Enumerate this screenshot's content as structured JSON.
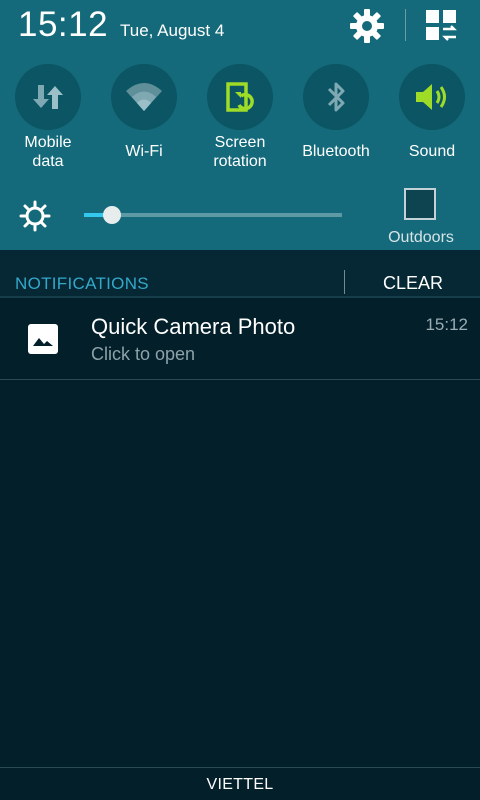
{
  "status": {
    "time": "15:12",
    "date": "Tue, August 4"
  },
  "toggles": [
    {
      "label": "Mobile\ndata",
      "icon": "mobile-data-icon",
      "active": false
    },
    {
      "label": "Wi-Fi",
      "icon": "wifi-icon",
      "active": false
    },
    {
      "label": "Screen\nrotation",
      "icon": "screen-rotation-icon",
      "active": true
    },
    {
      "label": "Bluetooth",
      "icon": "bluetooth-icon",
      "active": false
    },
    {
      "label": "Sound",
      "icon": "sound-icon",
      "active": true
    }
  ],
  "brightness": {
    "level": 0.11,
    "outdoors_label": "Outdoors"
  },
  "notifications": {
    "title": "NOTIFICATIONS",
    "clear_label": "CLEAR",
    "items": [
      {
        "app": "Quick Camera Photo",
        "subtitle": "Click to open",
        "time": "15:12",
        "icon": "image-icon"
      }
    ]
  },
  "footer": {
    "carrier": "VIETTEL"
  },
  "colors": {
    "panel": "#146a7a",
    "toggle_bg": "#0b5564",
    "active": "#9fdc28",
    "inactive_icon": "#7fa9b2",
    "accent": "#33c9ef",
    "background": "#031f2a"
  }
}
